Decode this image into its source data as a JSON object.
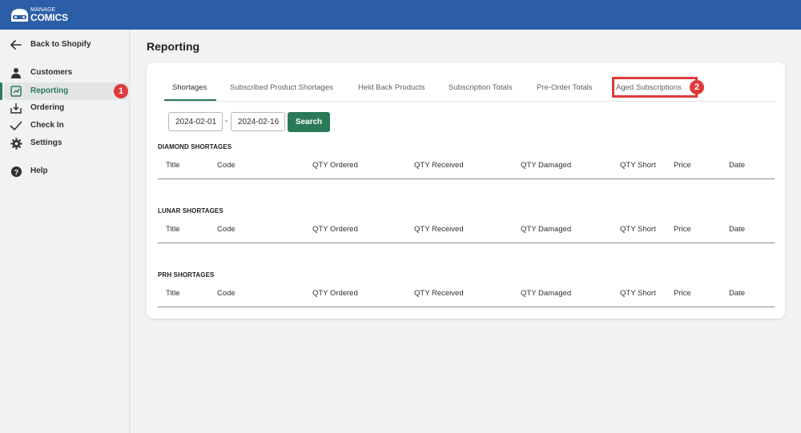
{
  "brand": {
    "line1": "MANAGE",
    "line2": "COMICS"
  },
  "sidebar": {
    "back": {
      "label": "Back to Shopify",
      "icon": "arrow-left-icon"
    },
    "items": [
      {
        "label": "Customers",
        "icon": "person-icon"
      },
      {
        "label": "Reporting",
        "icon": "report-icon",
        "active": true
      },
      {
        "label": "Ordering",
        "icon": "download-tray-icon"
      },
      {
        "label": "Check In",
        "icon": "checkmark-icon"
      },
      {
        "label": "Settings",
        "icon": "gear-icon"
      }
    ],
    "help": {
      "label": "Help",
      "icon": "question-circle-icon"
    }
  },
  "annotations": {
    "step1": "1",
    "step2": "2",
    "color": "#e03a3a"
  },
  "page": {
    "title": "Reporting"
  },
  "tabs": [
    {
      "label": "Shortages",
      "active": true
    },
    {
      "label": "Subscribed Product Shortages"
    },
    {
      "label": "Held Back Products"
    },
    {
      "label": "Subscription Totals"
    },
    {
      "label": "Pre-Order Totals"
    },
    {
      "label": "Aged Subscriptions",
      "highlighted": true
    }
  ],
  "filters": {
    "start_date": "2024-02-01",
    "end_date": "2024-02-16",
    "separator": "-",
    "search_label": "Search"
  },
  "columns": [
    "Title",
    "Code",
    "QTY Ordered",
    "QTY Received",
    "QTY Damaged",
    "QTY Short",
    "Price",
    "Date"
  ],
  "sections": [
    {
      "title": "DIAMOND SHORTAGES",
      "rows": []
    },
    {
      "title": "LUNAR SHORTAGES",
      "rows": []
    },
    {
      "title": "PRH SHORTAGES",
      "rows": []
    }
  ],
  "colors": {
    "topbar": "#2c5ea8",
    "accent": "#2a7a58",
    "annotation": "#e03a3a"
  }
}
